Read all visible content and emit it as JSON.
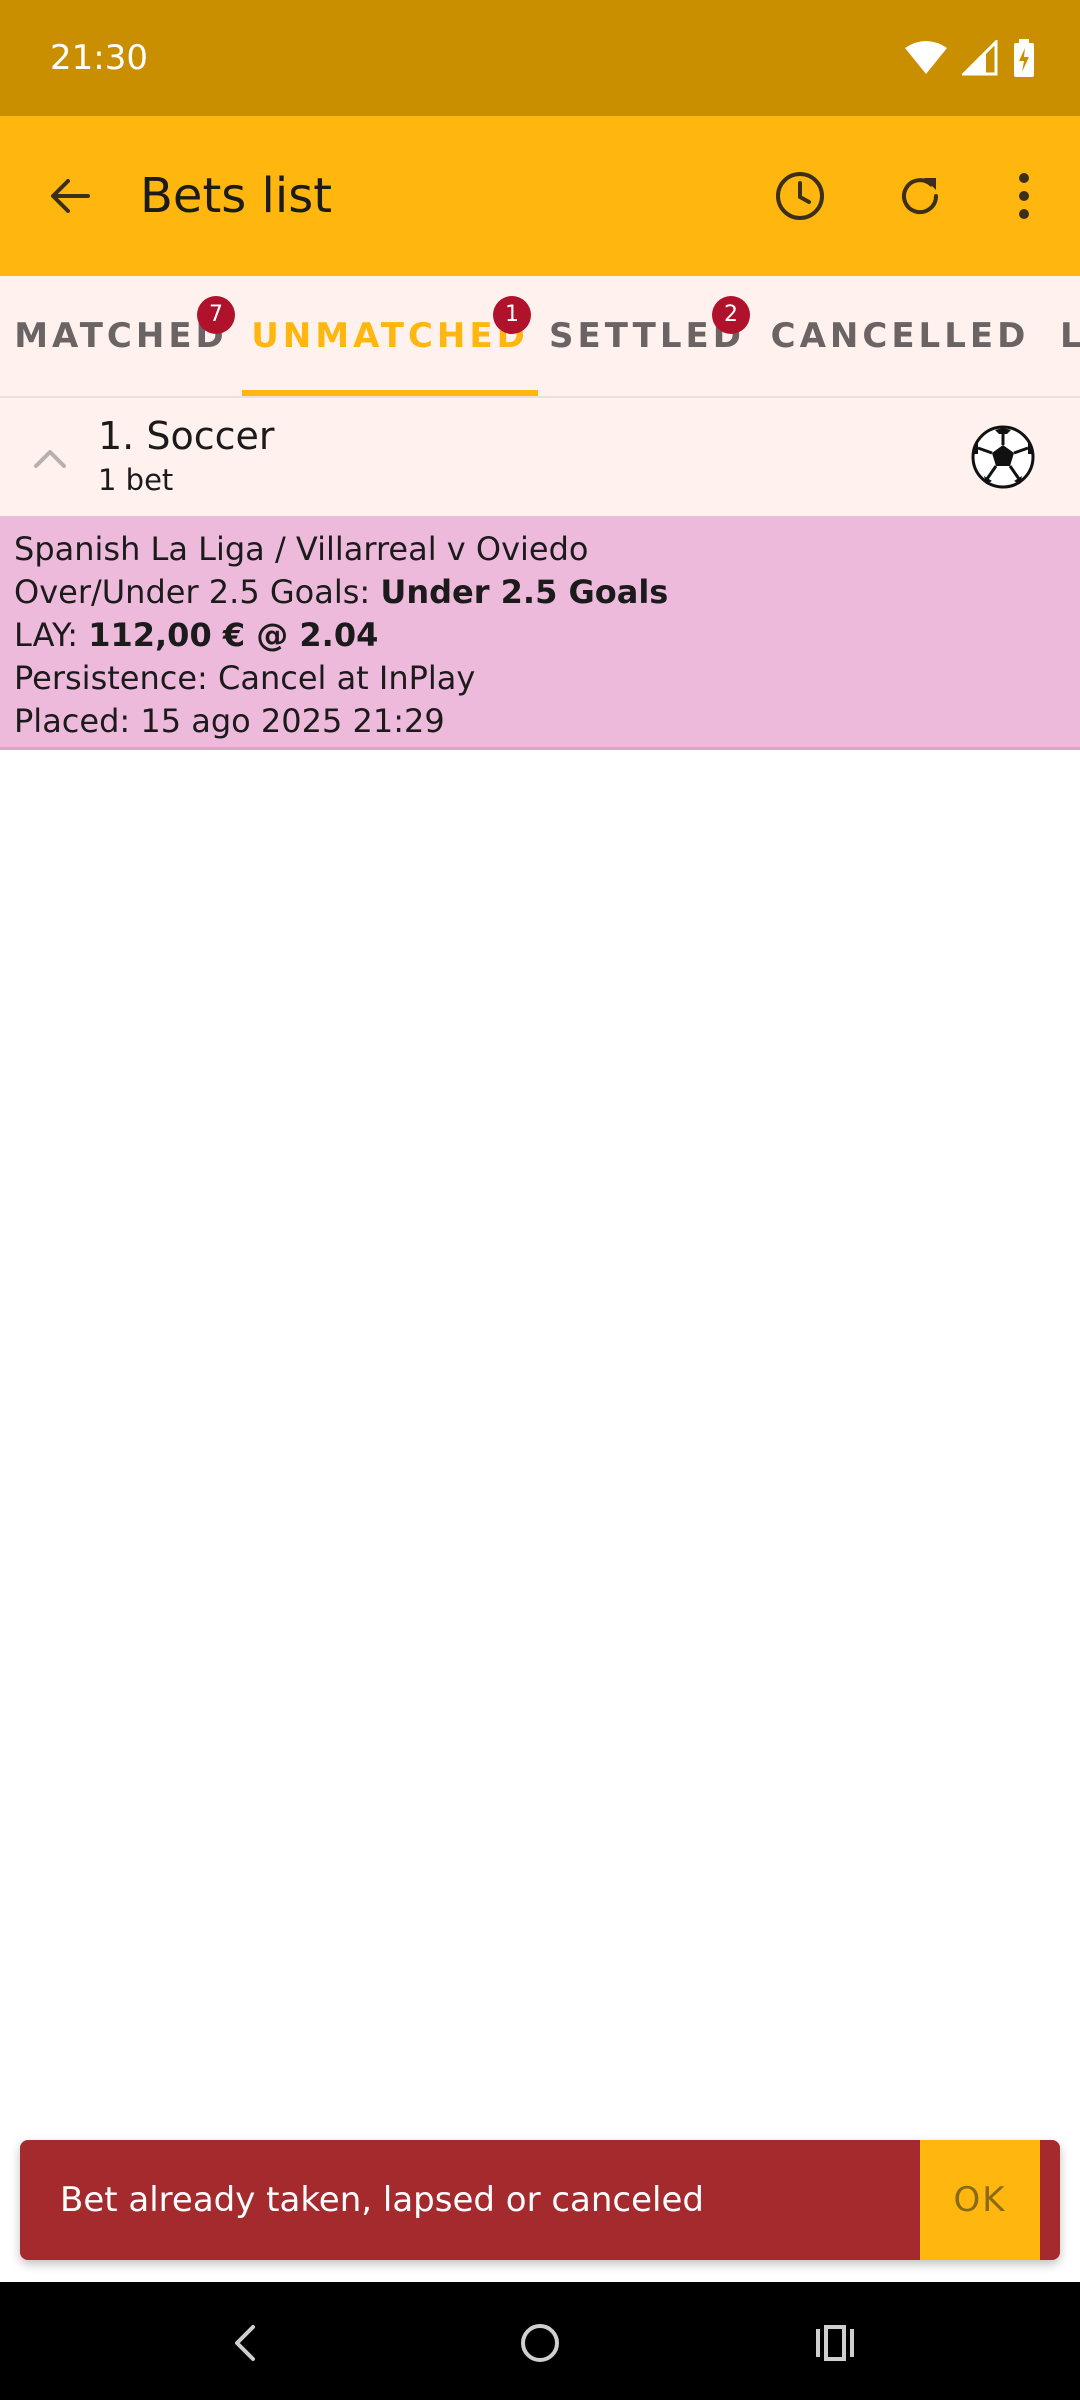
{
  "status_bar": {
    "time": "21:30",
    "icons": [
      "wifi-icon",
      "cell-signal-icon",
      "battery-charging-icon"
    ]
  },
  "app_bar": {
    "title": "Bets list",
    "actions": [
      "history-clock-icon",
      "refresh-icon",
      "more-vert-icon"
    ]
  },
  "tabs": [
    {
      "label": "MATCHED",
      "badge": "7"
    },
    {
      "label": "UNMATCHED",
      "badge": "1",
      "active": true
    },
    {
      "label": "SETTLED",
      "badge": "2"
    },
    {
      "label": "CANCELLED"
    },
    {
      "label": "L"
    }
  ],
  "group": {
    "title": "1. Soccer",
    "subtitle": "1 bet",
    "icon": "soccer-ball-icon"
  },
  "bet": {
    "event": "Spanish La Liga / Villarreal v Oviedo",
    "market_label": "Over/Under 2.5 Goals: ",
    "selection": "Under 2.5 Goals",
    "side_label": "LAY: ",
    "stake_odds": "112,00 € @ 2.04",
    "persistence": "Persistence: Cancel at InPlay",
    "placed": "Placed: 15 ago 2025 21:29"
  },
  "snackbar": {
    "message": "Bet already taken, lapsed or canceled",
    "action": "OK"
  },
  "colors": {
    "status_bar": "#C98F00",
    "app_bar": "#FFB70F",
    "tab_bg": "#FFF2EE",
    "badge": "#B0112B",
    "bet_card": "#EEBADB",
    "snackbar": "#A42A2E",
    "accent": "#FFB70F"
  }
}
